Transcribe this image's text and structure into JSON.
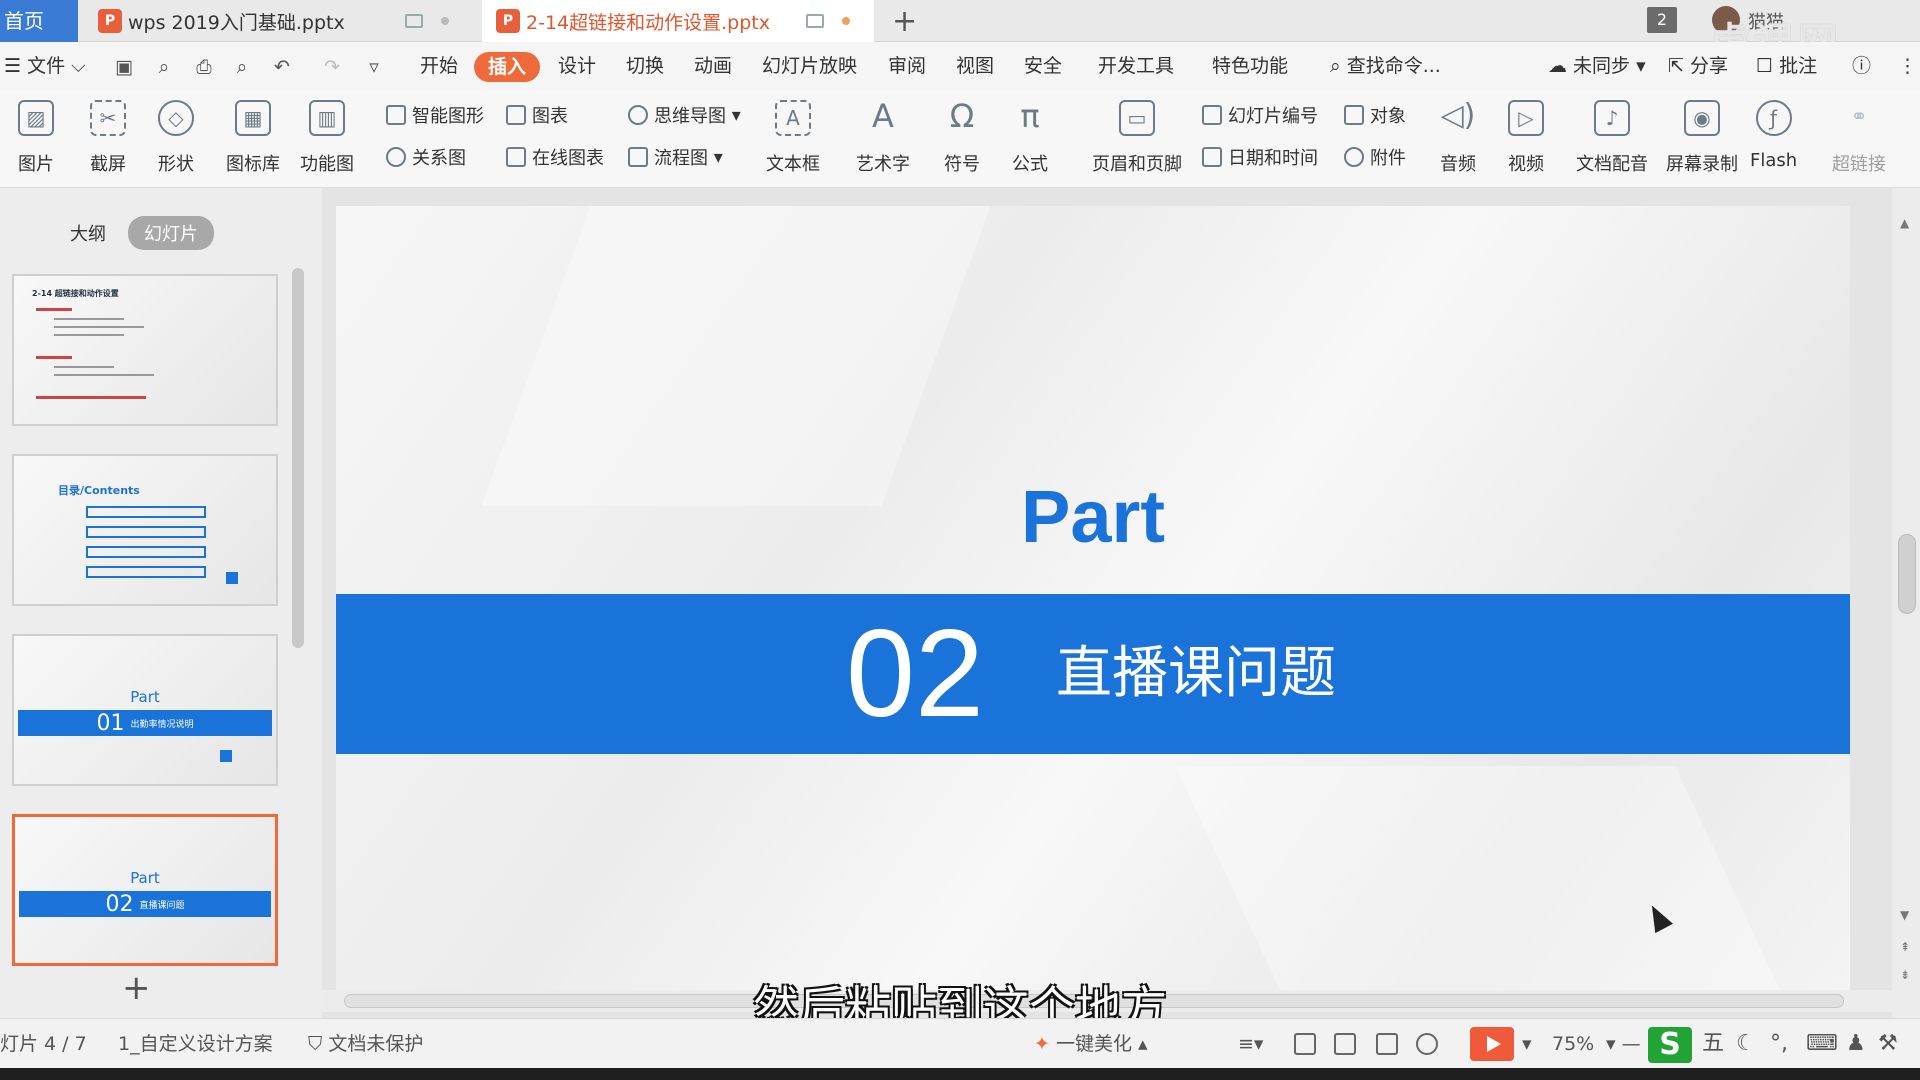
{
  "tabs": {
    "home": "首页",
    "doc1": "wps 2019入门基础.pptx",
    "doc2": "2-14超链接和动作设置.pptx",
    "window_count": "2",
    "user": "猫猫"
  },
  "watermark": "虎课网",
  "menu": {
    "file": "文件",
    "items": [
      "开始",
      "插入",
      "设计",
      "切换",
      "动画",
      "幻灯片放映",
      "审阅",
      "视图",
      "安全",
      "开发工具",
      "特色功能"
    ],
    "active_index": 1,
    "search": "查找命令...",
    "sync": "未同步",
    "share": "分享",
    "comment": "批注"
  },
  "ribbon": {
    "picture": "图片",
    "screenshot": "截屏",
    "shape": "形状",
    "icon_lib": "图标库",
    "function_chart": "功能图",
    "smart_shape": "智能图形",
    "chart": "图表",
    "mindmap": "思维导图",
    "relation": "关系图",
    "online_chart": "在线图表",
    "flowchart": "流程图",
    "textbox": "文本框",
    "art_text": "艺术字",
    "symbol": "符号",
    "formula": "公式",
    "header_footer": "页眉和页脚",
    "slide_number": "幻灯片编号",
    "object": "对象",
    "datetime": "日期和时间",
    "attachment": "附件",
    "audio": "音频",
    "video": "视频",
    "doc_dub": "文档配音",
    "screen_rec": "屏幕录制",
    "flash": "Flash",
    "hyperlink": "超链接"
  },
  "left_panel": {
    "tab_outline": "大纲",
    "tab_slides": "幻灯片",
    "thumb1_title": "2-14 超链接和动作设置",
    "thumb2_title": "目录/Contents",
    "thumb3": {
      "part": "Part",
      "num": "01",
      "text": "出勤率情况说明"
    },
    "thumb4": {
      "part": "Part",
      "num": "02",
      "text": "直播课问题"
    }
  },
  "slide": {
    "part": "Part",
    "number": "02",
    "title": "直播课问题"
  },
  "subtitle": "然后粘贴到这个地方",
  "status": {
    "slide_pos": "灯片 4 / 7",
    "design": "1_自定义设计方案",
    "protect": "文档未保护",
    "beautify": "一键美化",
    "zoom": "75%",
    "ime_wubi": "五"
  }
}
